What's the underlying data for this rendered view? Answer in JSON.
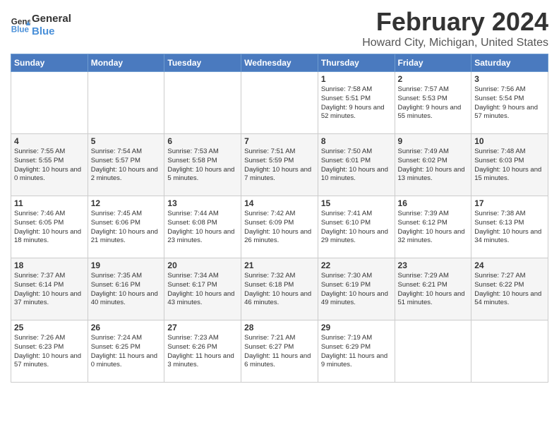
{
  "logo": {
    "line1": "General",
    "line2": "Blue"
  },
  "title": "February 2024",
  "location": "Howard City, Michigan, United States",
  "days_of_week": [
    "Sunday",
    "Monday",
    "Tuesday",
    "Wednesday",
    "Thursday",
    "Friday",
    "Saturday"
  ],
  "weeks": [
    [
      {
        "day": "",
        "content": ""
      },
      {
        "day": "",
        "content": ""
      },
      {
        "day": "",
        "content": ""
      },
      {
        "day": "",
        "content": ""
      },
      {
        "day": "1",
        "content": "Sunrise: 7:58 AM\nSunset: 5:51 PM\nDaylight: 9 hours\nand 52 minutes."
      },
      {
        "day": "2",
        "content": "Sunrise: 7:57 AM\nSunset: 5:53 PM\nDaylight: 9 hours\nand 55 minutes."
      },
      {
        "day": "3",
        "content": "Sunrise: 7:56 AM\nSunset: 5:54 PM\nDaylight: 9 hours\nand 57 minutes."
      }
    ],
    [
      {
        "day": "4",
        "content": "Sunrise: 7:55 AM\nSunset: 5:55 PM\nDaylight: 10 hours\nand 0 minutes."
      },
      {
        "day": "5",
        "content": "Sunrise: 7:54 AM\nSunset: 5:57 PM\nDaylight: 10 hours\nand 2 minutes."
      },
      {
        "day": "6",
        "content": "Sunrise: 7:53 AM\nSunset: 5:58 PM\nDaylight: 10 hours\nand 5 minutes."
      },
      {
        "day": "7",
        "content": "Sunrise: 7:51 AM\nSunset: 5:59 PM\nDaylight: 10 hours\nand 7 minutes."
      },
      {
        "day": "8",
        "content": "Sunrise: 7:50 AM\nSunset: 6:01 PM\nDaylight: 10 hours\nand 10 minutes."
      },
      {
        "day": "9",
        "content": "Sunrise: 7:49 AM\nSunset: 6:02 PM\nDaylight: 10 hours\nand 13 minutes."
      },
      {
        "day": "10",
        "content": "Sunrise: 7:48 AM\nSunset: 6:03 PM\nDaylight: 10 hours\nand 15 minutes."
      }
    ],
    [
      {
        "day": "11",
        "content": "Sunrise: 7:46 AM\nSunset: 6:05 PM\nDaylight: 10 hours\nand 18 minutes."
      },
      {
        "day": "12",
        "content": "Sunrise: 7:45 AM\nSunset: 6:06 PM\nDaylight: 10 hours\nand 21 minutes."
      },
      {
        "day": "13",
        "content": "Sunrise: 7:44 AM\nSunset: 6:08 PM\nDaylight: 10 hours\nand 23 minutes."
      },
      {
        "day": "14",
        "content": "Sunrise: 7:42 AM\nSunset: 6:09 PM\nDaylight: 10 hours\nand 26 minutes."
      },
      {
        "day": "15",
        "content": "Sunrise: 7:41 AM\nSunset: 6:10 PM\nDaylight: 10 hours\nand 29 minutes."
      },
      {
        "day": "16",
        "content": "Sunrise: 7:39 AM\nSunset: 6:12 PM\nDaylight: 10 hours\nand 32 minutes."
      },
      {
        "day": "17",
        "content": "Sunrise: 7:38 AM\nSunset: 6:13 PM\nDaylight: 10 hours\nand 34 minutes."
      }
    ],
    [
      {
        "day": "18",
        "content": "Sunrise: 7:37 AM\nSunset: 6:14 PM\nDaylight: 10 hours\nand 37 minutes."
      },
      {
        "day": "19",
        "content": "Sunrise: 7:35 AM\nSunset: 6:16 PM\nDaylight: 10 hours\nand 40 minutes."
      },
      {
        "day": "20",
        "content": "Sunrise: 7:34 AM\nSunset: 6:17 PM\nDaylight: 10 hours\nand 43 minutes."
      },
      {
        "day": "21",
        "content": "Sunrise: 7:32 AM\nSunset: 6:18 PM\nDaylight: 10 hours\nand 46 minutes."
      },
      {
        "day": "22",
        "content": "Sunrise: 7:30 AM\nSunset: 6:19 PM\nDaylight: 10 hours\nand 49 minutes."
      },
      {
        "day": "23",
        "content": "Sunrise: 7:29 AM\nSunset: 6:21 PM\nDaylight: 10 hours\nand 51 minutes."
      },
      {
        "day": "24",
        "content": "Sunrise: 7:27 AM\nSunset: 6:22 PM\nDaylight: 10 hours\nand 54 minutes."
      }
    ],
    [
      {
        "day": "25",
        "content": "Sunrise: 7:26 AM\nSunset: 6:23 PM\nDaylight: 10 hours\nand 57 minutes."
      },
      {
        "day": "26",
        "content": "Sunrise: 7:24 AM\nSunset: 6:25 PM\nDaylight: 11 hours\nand 0 minutes."
      },
      {
        "day": "27",
        "content": "Sunrise: 7:23 AM\nSunset: 6:26 PM\nDaylight: 11 hours\nand 3 minutes."
      },
      {
        "day": "28",
        "content": "Sunrise: 7:21 AM\nSunset: 6:27 PM\nDaylight: 11 hours\nand 6 minutes."
      },
      {
        "day": "29",
        "content": "Sunrise: 7:19 AM\nSunset: 6:29 PM\nDaylight: 11 hours\nand 9 minutes."
      },
      {
        "day": "",
        "content": ""
      },
      {
        "day": "",
        "content": ""
      }
    ]
  ]
}
